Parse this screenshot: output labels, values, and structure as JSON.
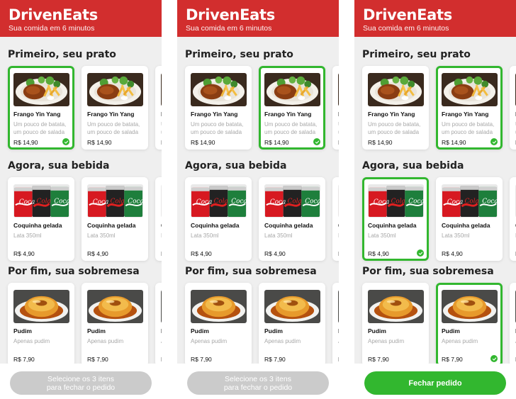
{
  "app": {
    "logo": "DrivenEats",
    "subtitle": "Sua comida em 6 minutos"
  },
  "sections": {
    "dish": "Primeiro, seu prato",
    "drink": "Agora, sua bebida",
    "dessert": "Por fim, sua sobremesa"
  },
  "items": {
    "dish": {
      "name": "Frango Yin Yang",
      "description": "Um pouco de batata, um pouco de salada",
      "price": "R$ 14,90",
      "image": "fried-chicken-with-fries-and-salad"
    },
    "drink": {
      "name": "Coquinha gelada",
      "description": "Lata 350ml",
      "price": "R$ 4,90",
      "image": "coca-cola-cans"
    },
    "dessert": {
      "name": "Pudim",
      "description": "Apenas pudim",
      "price": "R$ 7,90",
      "image": "flan-pudding"
    }
  },
  "panels": [
    {
      "selected": {
        "dish": 1,
        "drink": 0,
        "dessert": 0
      },
      "button_label": "Selecione os 3 itens\npara fechar o pedido",
      "button_enabled": false
    },
    {
      "selected": {
        "dish": 2,
        "drink": 0,
        "dessert": 0
      },
      "button_label": "Selecione os 3 itens\npara fechar o pedido",
      "button_enabled": false
    },
    {
      "selected": {
        "dish": 2,
        "drink": 1,
        "dessert": 2
      },
      "button_label": "Fechar pedido",
      "button_enabled": true
    }
  ],
  "colors": {
    "header": "#d22e2e",
    "selected_border": "#32b72f",
    "button_disabled": "#cbcbcb",
    "button_enabled": "#32b72f"
  },
  "icons": {
    "selected": "check-circle-icon"
  }
}
